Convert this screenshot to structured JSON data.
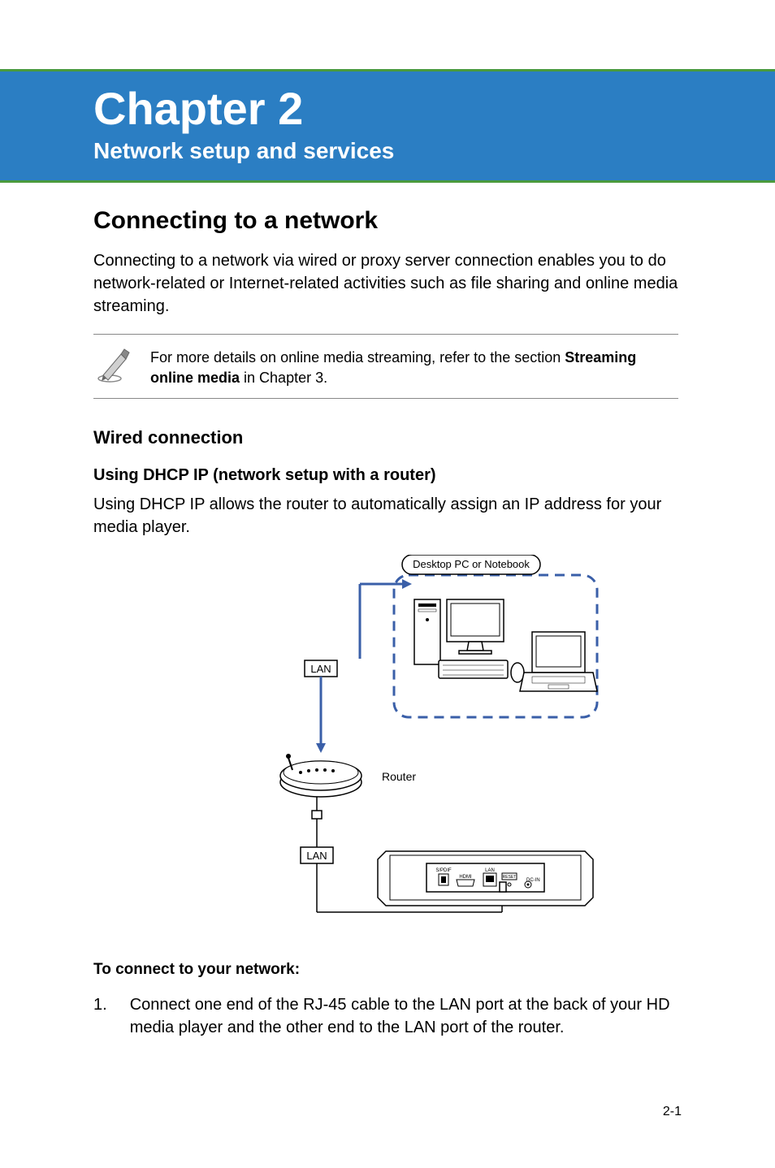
{
  "header": {
    "chapter_title": "Chapter 2",
    "chapter_subtitle": "Network setup and services"
  },
  "section": {
    "heading": "Connecting to a network",
    "intro": "Connecting to a network via wired or proxy server connection enables you to do network-related or Internet-related activities such as file sharing and online media streaming."
  },
  "note": {
    "text_prefix": "For more details on online media streaming, refer to the section ",
    "text_bold": "Streaming online media",
    "text_suffix": " in Chapter 3."
  },
  "subsection": {
    "heading": "Wired connection"
  },
  "subsubsection": {
    "heading": "Using DHCP IP (network setup with a router)",
    "body": "Using DHCP IP allows the router to automatically assign an IP address for your media player."
  },
  "diagram": {
    "label_desktop": "Desktop PC or Notebook",
    "label_lan1": "LAN",
    "label_lan2": "LAN",
    "label_router": "Router",
    "port_labels": {
      "spdif": "S/PDIF",
      "hdmi": "HDMI",
      "lan": "LAN",
      "reset": "RESET",
      "dcin": "DC-IN"
    }
  },
  "instructions": {
    "heading": "To connect to your network:",
    "steps": [
      {
        "number": "1.",
        "text": "Connect one end of the RJ-45 cable to the LAN port at the back of your HD media player and the other end to the LAN port of the router."
      }
    ]
  },
  "page_number": "2-1"
}
